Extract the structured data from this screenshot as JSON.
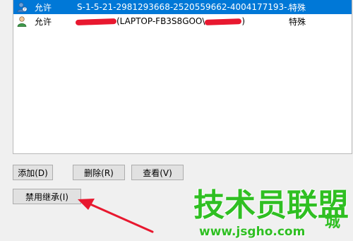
{
  "permission_list": {
    "rows": [
      {
        "access": "允许",
        "principal": "S-1-5-21-2981293668-2520559662-4004177193-...",
        "applies_to": "特殊",
        "selected": true,
        "icon": "unknown-user-icon"
      },
      {
        "access": "允许",
        "principal_visible": "(LAPTOP-FB3S8GOO\\",
        "principal_end": ")",
        "applies_to": "特殊",
        "selected": false,
        "icon": "user-icon",
        "redacted": true
      }
    ]
  },
  "buttons": {
    "add": "添加(D)",
    "remove": "删除(R)",
    "view": "查看(V)",
    "disable_inheritance": "禁用继承(I)"
  },
  "colors": {
    "selection": "#0078d7",
    "annotation_arrow": "#e8182f",
    "watermark": "#2fbf22"
  },
  "watermark": {
    "logo_text": "技术员联盟",
    "city_text": "城",
    "url": "www.jsgho.com"
  }
}
